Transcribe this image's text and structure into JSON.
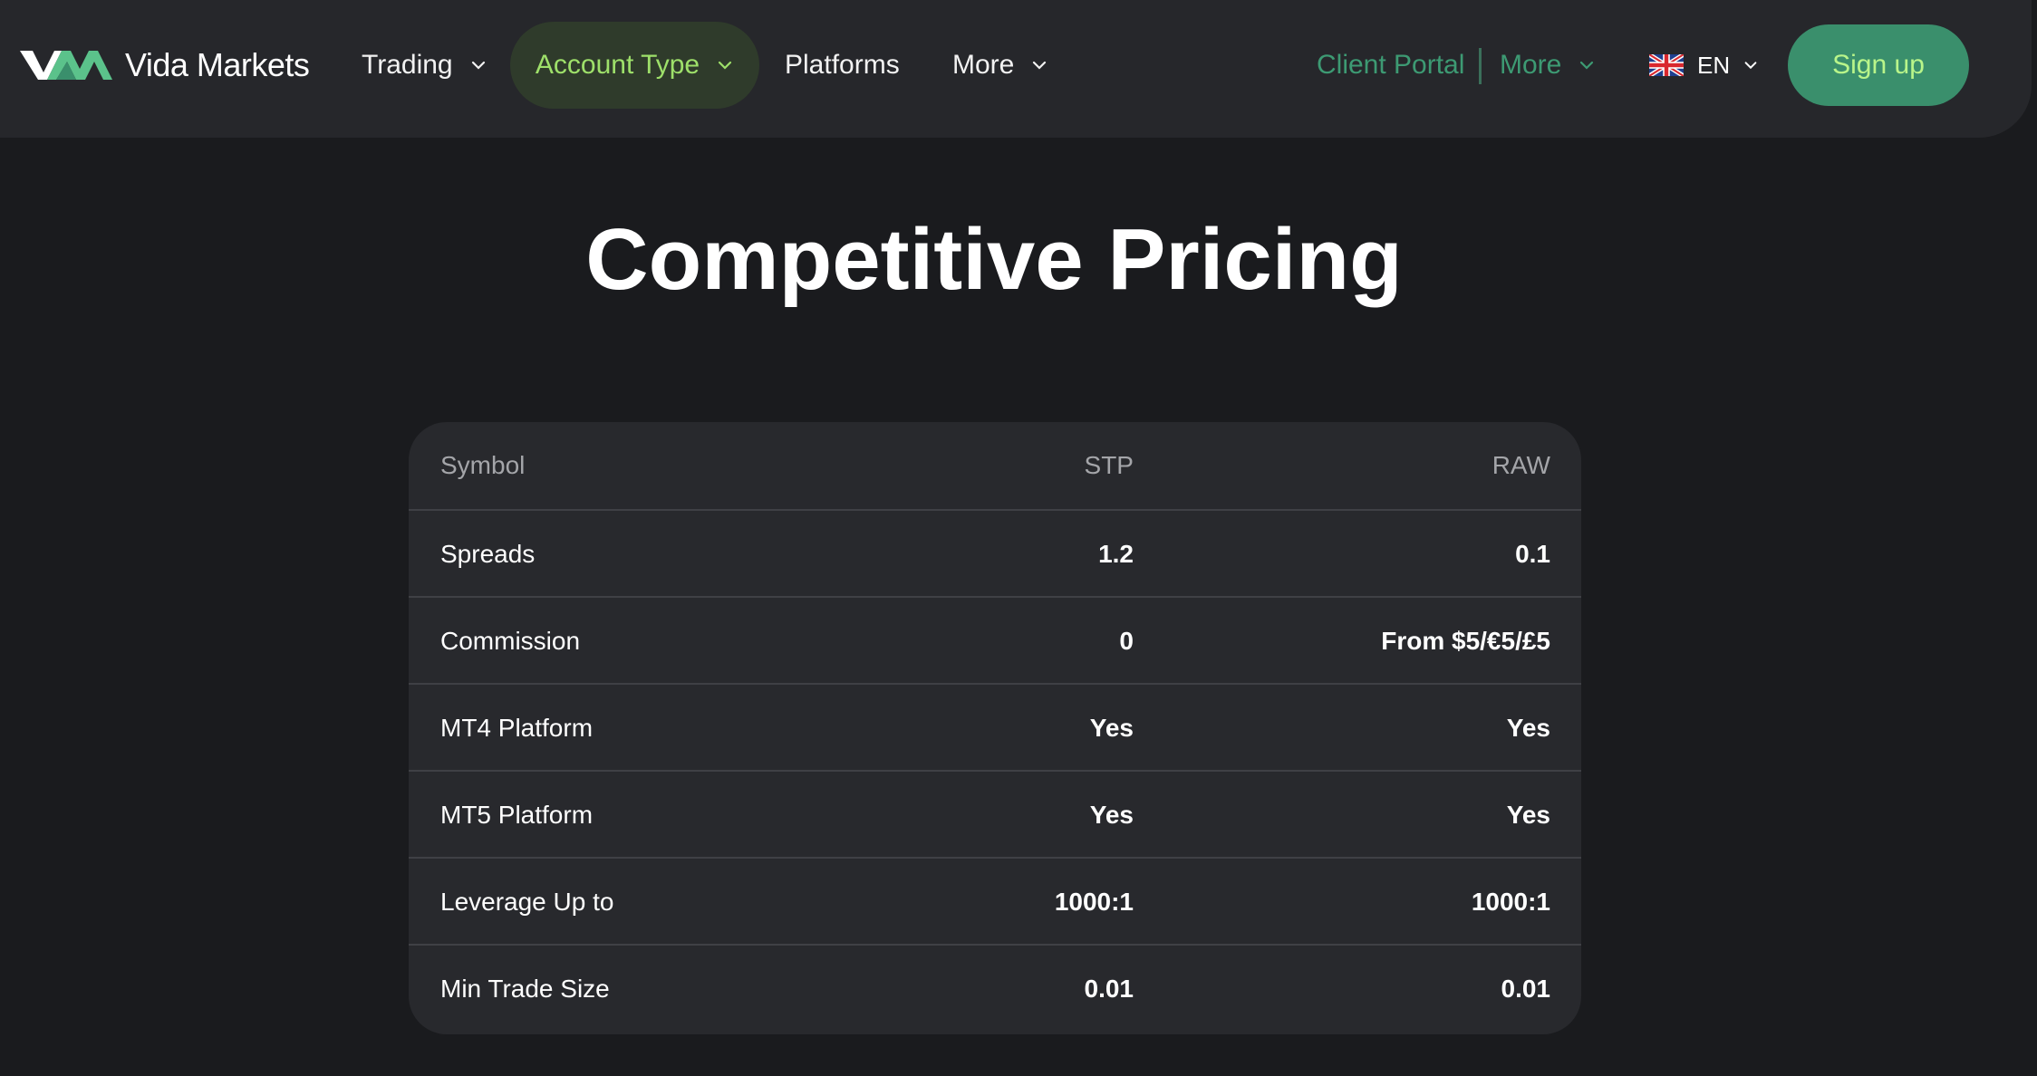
{
  "brand": {
    "name": "Vida Markets",
    "accent": "#3a8f6c",
    "highlight": "#9ee06a"
  },
  "nav": {
    "items": [
      {
        "label": "Trading",
        "has_dropdown": true
      },
      {
        "label": "Account Type",
        "has_dropdown": true,
        "active": true
      },
      {
        "label": "Platforms",
        "has_dropdown": false
      },
      {
        "label": "More",
        "has_dropdown": true
      }
    ]
  },
  "right_nav": {
    "client_portal": "Client Portal",
    "more": "More",
    "language": "EN",
    "language_icon": "uk-flag-icon",
    "signup": "Sign up"
  },
  "page_title": "Competitive Pricing",
  "pricing_table": {
    "headers": [
      "Symbol",
      "STP",
      "RAW"
    ],
    "rows": [
      [
        "Spreads",
        "1.2",
        "0.1"
      ],
      [
        "Commission",
        "0",
        "From $5/€5/£5"
      ],
      [
        "MT4 Platform",
        "Yes",
        "Yes"
      ],
      [
        "MT5 Platform",
        "Yes",
        "Yes"
      ],
      [
        "Leverage Up to",
        "1000:1",
        "1000:1"
      ],
      [
        "Min Trade Size",
        "0.01",
        "0.01"
      ]
    ]
  }
}
